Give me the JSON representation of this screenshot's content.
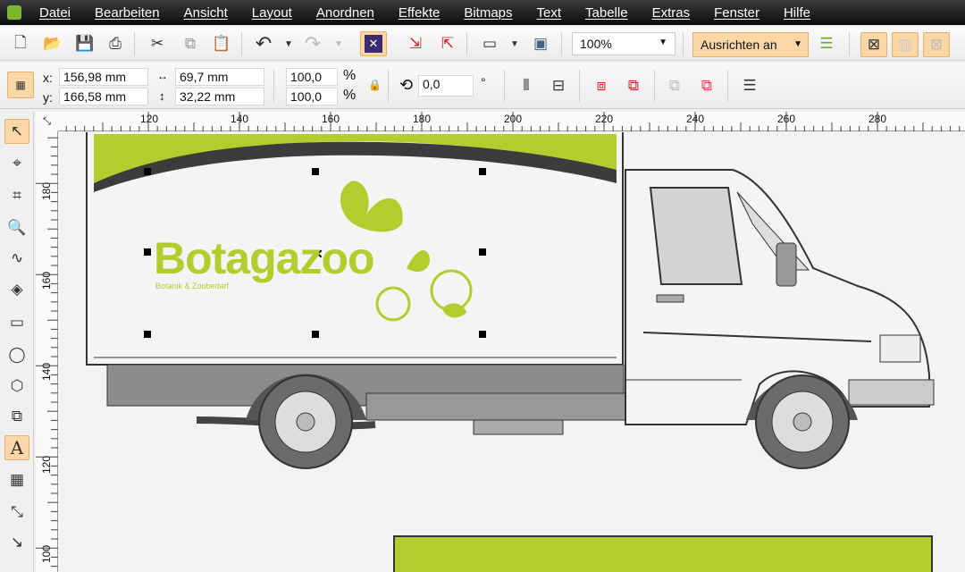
{
  "menu": [
    "Datei",
    "Bearbeiten",
    "Ansicht",
    "Layout",
    "Anordnen",
    "Effekte",
    "Bitmaps",
    "Text",
    "Tabelle",
    "Extras",
    "Fenster",
    "Hilfe"
  ],
  "toolbar": {
    "zoom": "100%",
    "snap": "Ausrichten an"
  },
  "props": {
    "x_label": "x:",
    "x": "156,98 mm",
    "y_label": "y:",
    "y": "166,58 mm",
    "width": "69,7 mm",
    "height": "32,22 mm",
    "scale_x": "100,0",
    "scale_y": "100,0",
    "pct": "%",
    "rotation": "0,0",
    "deg": "°"
  },
  "ruler": {
    "h": [
      "120",
      "140",
      "160",
      "180",
      "200",
      "220",
      "240",
      "260",
      "280"
    ],
    "v": [
      "180",
      "160",
      "140",
      "120",
      "100"
    ]
  },
  "design": {
    "brand": "Botagazoo",
    "tagline": "Botanik & Zoobedarf"
  },
  "colors": {
    "accent": "#b5cc2e",
    "menubar": "#1a1a1a"
  }
}
